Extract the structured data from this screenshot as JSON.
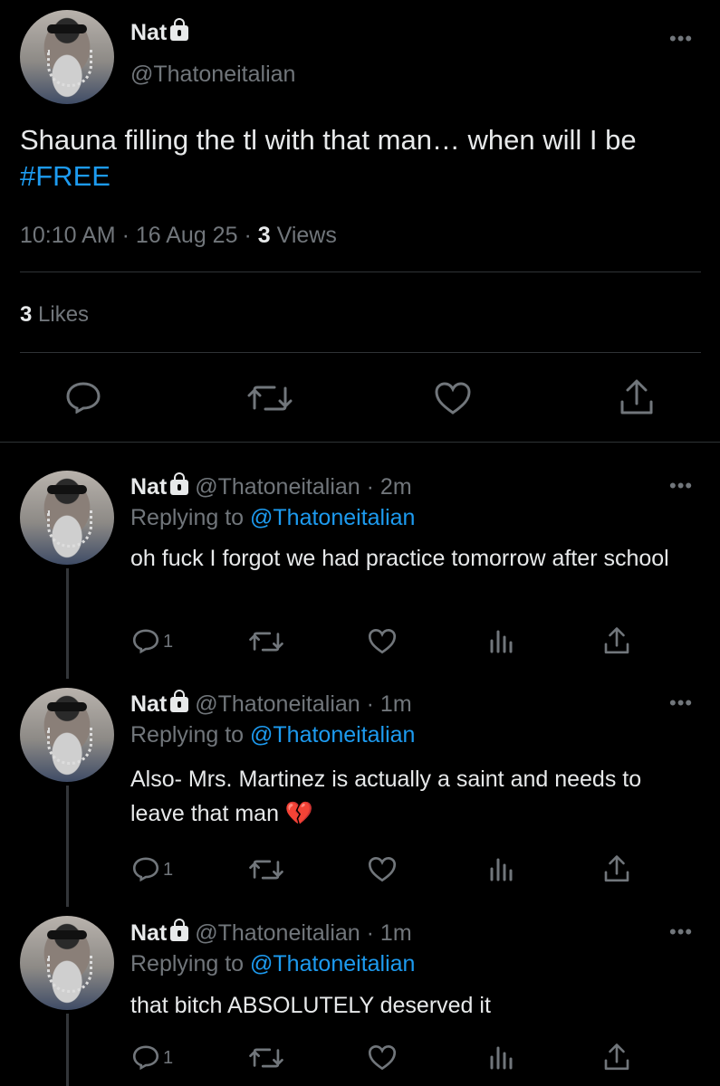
{
  "main_tweet": {
    "author_name": "Nat",
    "handle": "@Thatoneitalian",
    "text_before": "Shauna filling the tl with that man… when will I be ",
    "hashtag": "#FREE",
    "time": "10:10 AM",
    "dot1": "·",
    "date": "16 Aug 25",
    "dot2": "·",
    "views_count": "3",
    "views_label": "Views",
    "likes_count": "3",
    "likes_label": "Likes"
  },
  "replies": [
    {
      "author_name": "Nat",
      "handle": "@Thatoneitalian",
      "age": "· 2m",
      "replying_prefix": "Replying to",
      "replying_handle": "@Thatoneitalian",
      "text": "oh fuck I forgot we had practice tomorrow after school",
      "reply_count": "1"
    },
    {
      "author_name": "Nat",
      "handle": "@Thatoneitalian",
      "age": "· 1m",
      "replying_prefix": "Replying to",
      "replying_handle": "@Thatoneitalian",
      "text": "Also- Mrs. Martinez is actually a saint and needs to leave that man 💔",
      "reply_count": "1"
    },
    {
      "author_name": "Nat",
      "handle": "@Thatoneitalian",
      "age": "· 1m",
      "replying_prefix": "Replying to",
      "replying_handle": "@Thatoneitalian",
      "text": "that bitch ABSOLUTELY deserved it",
      "reply_count": "1"
    }
  ],
  "icons": {
    "more": "more-icon",
    "reply": "reply-icon",
    "retweet": "retweet-icon",
    "like": "heart-icon",
    "views": "analytics-icon",
    "share": "share-icon",
    "lock": "lock-icon"
  },
  "colors": {
    "background": "#000000",
    "text": "#e7e9ea",
    "muted": "#71767b",
    "link": "#1d9bf0"
  }
}
